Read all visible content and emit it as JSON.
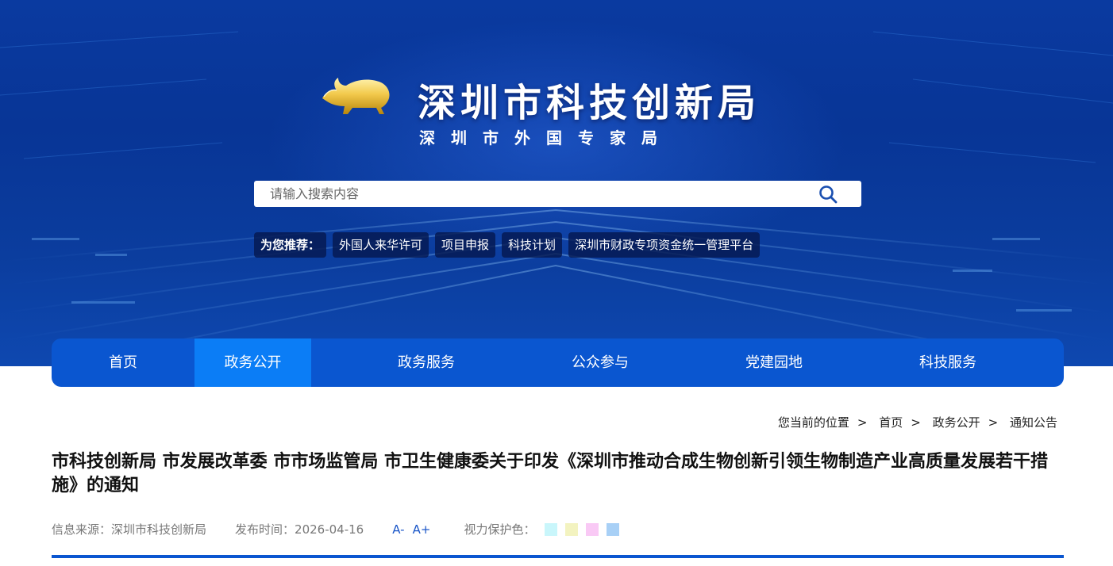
{
  "header": {
    "title": "深圳市科技创新局",
    "subtitle": "深圳市外国专家局"
  },
  "search": {
    "placeholder": "请输入搜索内容"
  },
  "recommend": {
    "label": "为您推荐：",
    "items": [
      "外国人来华许可",
      "项目申报",
      "科技计划",
      "深圳市财政专项资金统一管理平台"
    ]
  },
  "nav": {
    "items": [
      "首页",
      "政务公开",
      "政务服务",
      "公众参与",
      "党建园地",
      "科技服务"
    ],
    "active": "政务公开"
  },
  "breadcrumb": {
    "label": "您当前的位置",
    "items": [
      "首页",
      "政务公开",
      "通知公告"
    ]
  },
  "article": {
    "title": "市科技创新局 市发展改革委 市市场监管局 市卫生健康委关于印发《深圳市推动合成生物创新引领生物制造产业高质量发展若干措施》的通知",
    "source_label": "信息来源：",
    "source": "深圳市科技创新局",
    "date_label": "发布时间：",
    "date": "2026-04-16",
    "font_smaller": "A-",
    "font_larger": "A+",
    "eye_care_label": "视力保护色：",
    "eye_care_colors": [
      "#c9f6fb",
      "#f3f3c0",
      "#f9c9f5",
      "#a8d0f6"
    ]
  },
  "colors": {
    "nav_bg": "#0a56d0",
    "nav_active": "#0b7df6",
    "link_blue": "#1a56c8"
  }
}
